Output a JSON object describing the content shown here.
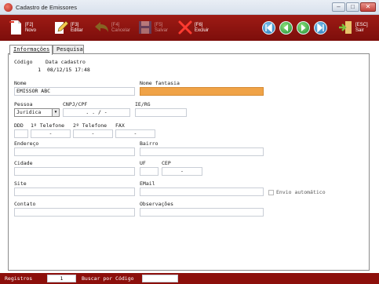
{
  "window": {
    "title": "Cadastro de Emissores",
    "controls": {
      "minimize": "–",
      "maximize": "□",
      "close": "✕"
    }
  },
  "toolbar": {
    "novo": {
      "key": "[F2]",
      "label": "Novo"
    },
    "editar": {
      "key": "[F3]",
      "label": "Editar"
    },
    "cancelar": {
      "key": "[F4]",
      "label": "Cancelar"
    },
    "salvar": {
      "key": "[F5]",
      "label": "Salvar"
    },
    "excluir": {
      "key": "[F6]",
      "label": "Excluir"
    },
    "sair": {
      "key": "[ESC]",
      "label": "Sair"
    },
    "nav_colors": {
      "blue": "#2a7fc4",
      "green": "#2aa24a"
    }
  },
  "tabs": [
    {
      "label": "Informações",
      "active": true
    },
    {
      "label": "Pesquisa",
      "active": false
    }
  ],
  "form": {
    "codigo": {
      "label": "Código",
      "value": "1"
    },
    "data_cadastro": {
      "label": "Data cadastro",
      "value": "08/12/15 17:48"
    },
    "nome": {
      "label": "Nome",
      "value": "EMISSOR ABC"
    },
    "nome_fantasia": {
      "label": "Nome fantasia",
      "value": ""
    },
    "pessoa": {
      "label": "Pessoa",
      "value": "Juridica"
    },
    "cnpj_cpf": {
      "label": "CNPJ/CPF",
      "value": ".   .   /   -"
    },
    "ie_rg": {
      "label": "IE/RG",
      "value": ""
    },
    "ddd": {
      "label": "DDD",
      "value": ""
    },
    "telefone1": {
      "label": "1º Telefone",
      "value": "-"
    },
    "telefone2": {
      "label": "2º Telefone",
      "value": "-"
    },
    "fax": {
      "label": "FAX",
      "value": "-"
    },
    "endereco": {
      "label": "Endereço",
      "value": ""
    },
    "bairro": {
      "label": "Bairro",
      "value": ""
    },
    "cidade": {
      "label": "Cidade",
      "value": ""
    },
    "uf": {
      "label": "UF",
      "value": ""
    },
    "cep": {
      "label": "CEP",
      "value": "-"
    },
    "site": {
      "label": "Site",
      "value": ""
    },
    "email": {
      "label": "EMail",
      "value": ""
    },
    "envio_automatico": {
      "label": "Envio automático",
      "checked": false
    },
    "contato": {
      "label": "Contato",
      "value": ""
    },
    "observacoes": {
      "label": "Observações",
      "value": ""
    }
  },
  "statusbar": {
    "registros_label": "Registros",
    "registros_value": "1",
    "buscar_label": "Buscar por Código",
    "buscar_value": ""
  },
  "colors": {
    "toolbar_red": "#8c0f0b",
    "highlight_field": "#f0a347"
  }
}
